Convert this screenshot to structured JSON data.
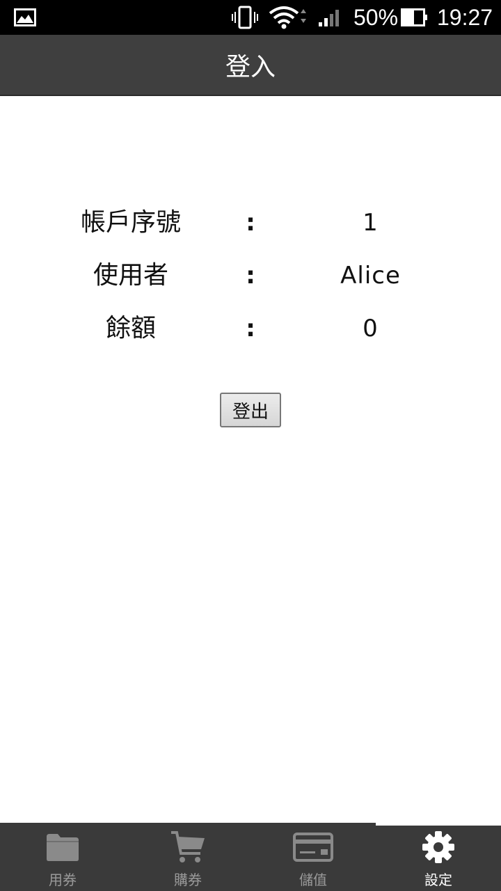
{
  "status_bar": {
    "battery": "50%",
    "time": "19:27",
    "icons": [
      "gallery-icon",
      "vibrate-icon",
      "wifi-icon",
      "signal-icon",
      "battery-icon"
    ]
  },
  "app_bar": {
    "title": "登入"
  },
  "account": {
    "rows": [
      {
        "label": "帳戶序號",
        "sep": ":",
        "value": "1"
      },
      {
        "label": "使用者",
        "sep": ":",
        "value": "Alice"
      },
      {
        "label": "餘額",
        "sep": ":",
        "value": "0"
      }
    ],
    "logout_label": "登出"
  },
  "tabs": [
    {
      "label": "用券",
      "icon": "folder-icon",
      "active": false
    },
    {
      "label": "購券",
      "icon": "cart-icon",
      "active": false
    },
    {
      "label": "儲值",
      "icon": "card-icon",
      "active": false
    },
    {
      "label": "設定",
      "icon": "gear-icon",
      "active": true
    }
  ],
  "colors": {
    "app_bar": "#3f3f3f",
    "tab_bar": "#3a3a3a",
    "inactive_tab": "#9a9a9a",
    "active_tab": "#ffffff"
  }
}
